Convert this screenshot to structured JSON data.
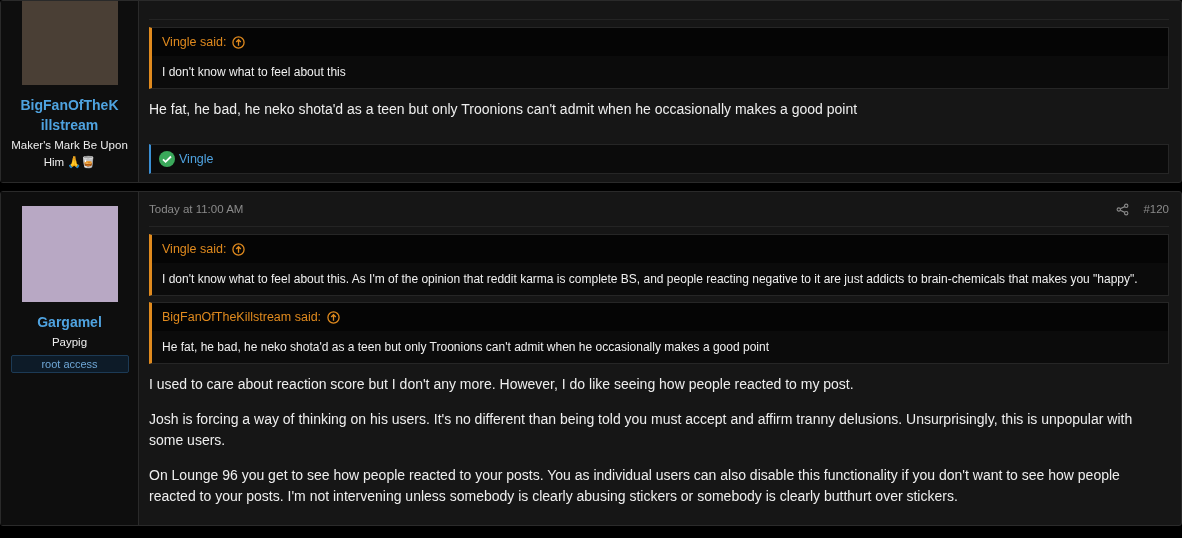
{
  "posts": [
    {
      "user": {
        "name": "BigFanOfTheKillstream",
        "title": "Maker's Mark Be Upon Him 🙏🥃"
      },
      "quotes": [
        {
          "author": "Vingle said:",
          "text": "I don't know what to feel about this"
        }
      ],
      "paragraphs": [
        "He fat, he bad, he neko shota'd as a teen but only Troonions can't admit when he occasionally makes a good point"
      ],
      "reactions": [
        {
          "name": "Vingle"
        }
      ]
    },
    {
      "user": {
        "name": "Gargamel",
        "title": "Paypig",
        "banner": "root access"
      },
      "header": {
        "date": "Today at 11:00 AM",
        "number": "#120"
      },
      "quotes": [
        {
          "author": "Vingle said:",
          "text": "I don't know what to feel about this. As I'm of the opinion that reddit karma is complete BS, and people reacting negative to it are just addicts to brain-chemicals that makes you \"happy\"."
        },
        {
          "author": "BigFanOfTheKillstream said:",
          "text": "He fat, he bad, he neko shota'd as a teen but only Troonions can't admit when he occasionally makes a good point"
        }
      ],
      "paragraphs": [
        "I used to care about reaction score but I don't any more. However, I do like seeing how people reacted to my post.",
        "Josh is forcing a way of thinking on his users. It's no different than being told you must accept and affirm tranny delusions. Unsurprisingly, this is unpopular with some users.",
        "On Lounge 96 you get to see how people reacted to your posts. You as individual users can also disable this functionality if you don't want to see how people reacted to your posts. I'm not intervening unless somebody is clearly abusing stickers or somebody is clearly butthurt over stickers."
      ]
    }
  ]
}
